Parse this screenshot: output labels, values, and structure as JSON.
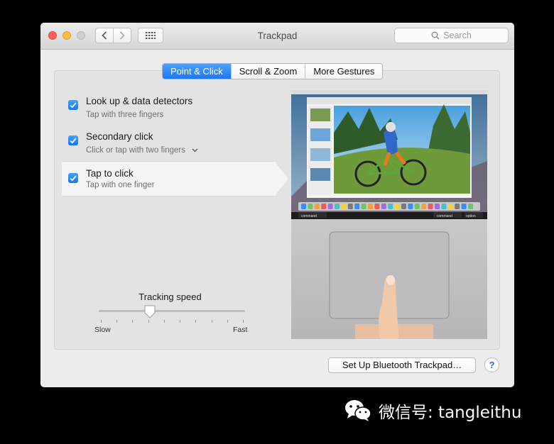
{
  "window": {
    "title": "Trackpad",
    "search_placeholder": "Search"
  },
  "tabs": [
    {
      "label": "Point & Click",
      "active": true
    },
    {
      "label": "Scroll & Zoom",
      "active": false
    },
    {
      "label": "More Gestures",
      "active": false
    }
  ],
  "options": [
    {
      "title": "Look up & data detectors",
      "subtitle": "Tap with three fingers",
      "checked": true
    },
    {
      "title": "Secondary click",
      "subtitle": "Click or tap with two fingers",
      "checked": true,
      "has_dropdown": true
    },
    {
      "title": "Tap to click",
      "subtitle": "Tap with one finger",
      "checked": true,
      "selected": true
    }
  ],
  "tracking": {
    "label": "Tracking speed",
    "min_label": "Slow",
    "max_label": "Fast",
    "value_fraction": 0.35,
    "tick_count": 10
  },
  "preview": {
    "keyboard_keys": [
      "command",
      "command",
      "option"
    ]
  },
  "footer": {
    "bluetooth_button": "Set Up Bluetooth Trackpad…",
    "help_label": "?"
  },
  "watermark": {
    "text": "微信号: tangleithu"
  },
  "colors": {
    "accent": "#1a78f5",
    "close": "#fc605c",
    "minimize": "#fdbc40"
  }
}
